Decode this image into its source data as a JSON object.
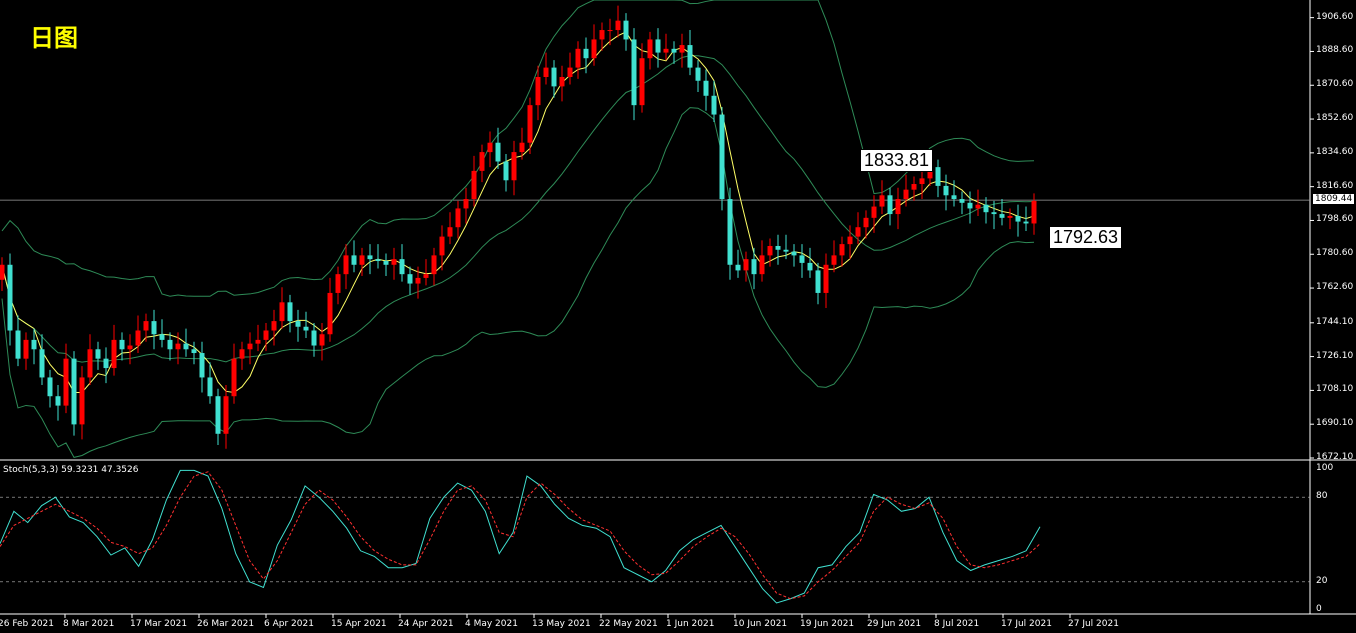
{
  "title": "日图",
  "current_price_label": "1809.44",
  "callouts": {
    "high": "1833.81",
    "low": "1792.63"
  },
  "stoch_label": "Stoch(5,3,3) 59.3231 47.3526",
  "colors": {
    "background": "#000000",
    "bull": "#ff0000",
    "bear": "#40e0d0",
    "bands": "#2e8b57",
    "ma": "#ffff66",
    "stoch_main": "#40e0d0",
    "stoch_signal": "#ff3030"
  },
  "chart_data": {
    "type": "candlestick",
    "instrument_note": "",
    "y_axis": {
      "ticks": [
        "1906.60",
        "1888.60",
        "1870.60",
        "1852.60",
        "1834.60",
        "1816.60",
        "1798.60",
        "1780.60",
        "1762.60",
        "1744.10",
        "1726.10",
        "1708.10",
        "1690.10",
        "1672.10"
      ],
      "ylim": [
        1672.1,
        1916
      ]
    },
    "x_axis": {
      "ticks": [
        "26 Feb 2021",
        "8 Mar 2021",
        "17 Mar 2021",
        "26 Mar 2021",
        "6 Apr 2021",
        "15 Apr 2021",
        "24 Apr 2021",
        "4 May 2021",
        "13 May 2021",
        "22 May 2021",
        "1 Jun 2021",
        "10 Jun 2021",
        "19 Jun 2021",
        "29 Jun 2021",
        "8 Jul 2021",
        "17 Jul 2021",
        "27 Jul 2021"
      ]
    },
    "close": [
      1775,
      1740,
      1725,
      1735,
      1730,
      1715,
      1705,
      1700,
      1725,
      1690,
      1715,
      1730,
      1725,
      1720,
      1735,
      1730,
      1732,
      1740,
      1745,
      1738,
      1735,
      1730,
      1733,
      1730,
      1728,
      1715,
      1705,
      1685,
      1705,
      1725,
      1730,
      1733,
      1735,
      1740,
      1745,
      1755,
      1745,
      1742,
      1740,
      1732,
      1738,
      1760,
      1770,
      1780,
      1775,
      1780,
      1778,
      1777,
      1775,
      1778,
      1770,
      1765,
      1768,
      1770,
      1780,
      1790,
      1795,
      1805,
      1810,
      1825,
      1835,
      1840,
      1830,
      1820,
      1835,
      1840,
      1860,
      1875,
      1880,
      1870,
      1875,
      1880,
      1890,
      1885,
      1895,
      1900,
      1900,
      1905,
      1895,
      1860,
      1885,
      1895,
      1888,
      1890,
      1888,
      1892,
      1880,
      1873,
      1865,
      1855,
      1810,
      1775,
      1772,
      1778,
      1770,
      1780,
      1785,
      1783,
      1782,
      1780,
      1776,
      1772,
      1760,
      1775,
      1780,
      1786,
      1790,
      1795,
      1800,
      1806,
      1812,
      1802,
      1810,
      1815,
      1818,
      1821,
      1827,
      1817,
      1812,
      1810,
      1808,
      1805,
      1807,
      1803,
      1802,
      1800,
      1801,
      1798,
      1797,
      1809
    ],
    "stoch": {
      "main": [
        47,
        70,
        62,
        74,
        80,
        66,
        62,
        52,
        39,
        44,
        31,
        50,
        78,
        99,
        99,
        95,
        72,
        40,
        20,
        16,
        46,
        64,
        88,
        80,
        70,
        58,
        42,
        38,
        30,
        30,
        33,
        65,
        80,
        90,
        85,
        70,
        40,
        55,
        95,
        88,
        75,
        65,
        60,
        58,
        52,
        30,
        25,
        20,
        28,
        42,
        50,
        55,
        60,
        45,
        30,
        15,
        5,
        8,
        12,
        30,
        32,
        45,
        55,
        82,
        78,
        70,
        72,
        80,
        55,
        35,
        28,
        32,
        35,
        38,
        42,
        59
      ],
      "signal": [
        45,
        60,
        65,
        70,
        75,
        70,
        65,
        58,
        48,
        45,
        40,
        44,
        60,
        80,
        95,
        98,
        85,
        60,
        35,
        22,
        35,
        55,
        75,
        85,
        78,
        66,
        52,
        42,
        36,
        32,
        32,
        50,
        70,
        85,
        88,
        78,
        55,
        52,
        80,
        90,
        82,
        72,
        64,
        60,
        56,
        42,
        32,
        25,
        26,
        35,
        45,
        52,
        58,
        52,
        40,
        25,
        12,
        8,
        10,
        20,
        28,
        38,
        48,
        70,
        80,
        75,
        72,
        76,
        65,
        45,
        32,
        30,
        32,
        35,
        38,
        47
      ],
      "levels": [
        80,
        20
      ],
      "ticks": [
        "100",
        "80",
        "20",
        "0"
      ]
    }
  }
}
